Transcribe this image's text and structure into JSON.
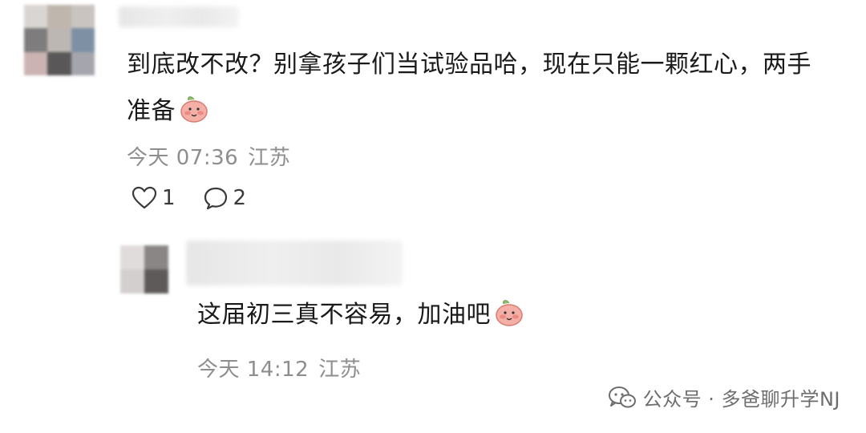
{
  "comment": {
    "text": "到底改不改？别拿孩子们当试验品哈，现在只能一颗红心，两手准备",
    "emoji": "peach-face-emoji",
    "time": "今天 07:36",
    "location": "江苏",
    "likes": "1",
    "replies": "2"
  },
  "reply": {
    "text": "这届初三真不容易，加油吧",
    "emoji": "peach-face-emoji",
    "time": "今天 14:12",
    "location": "江苏"
  },
  "watermark": {
    "text": "公众号 · 多爸聊升学NJ"
  },
  "colors": {
    "text": "#1a1a1a",
    "meta": "#8e8e8e",
    "emoji_fill": "#f2a29a"
  }
}
